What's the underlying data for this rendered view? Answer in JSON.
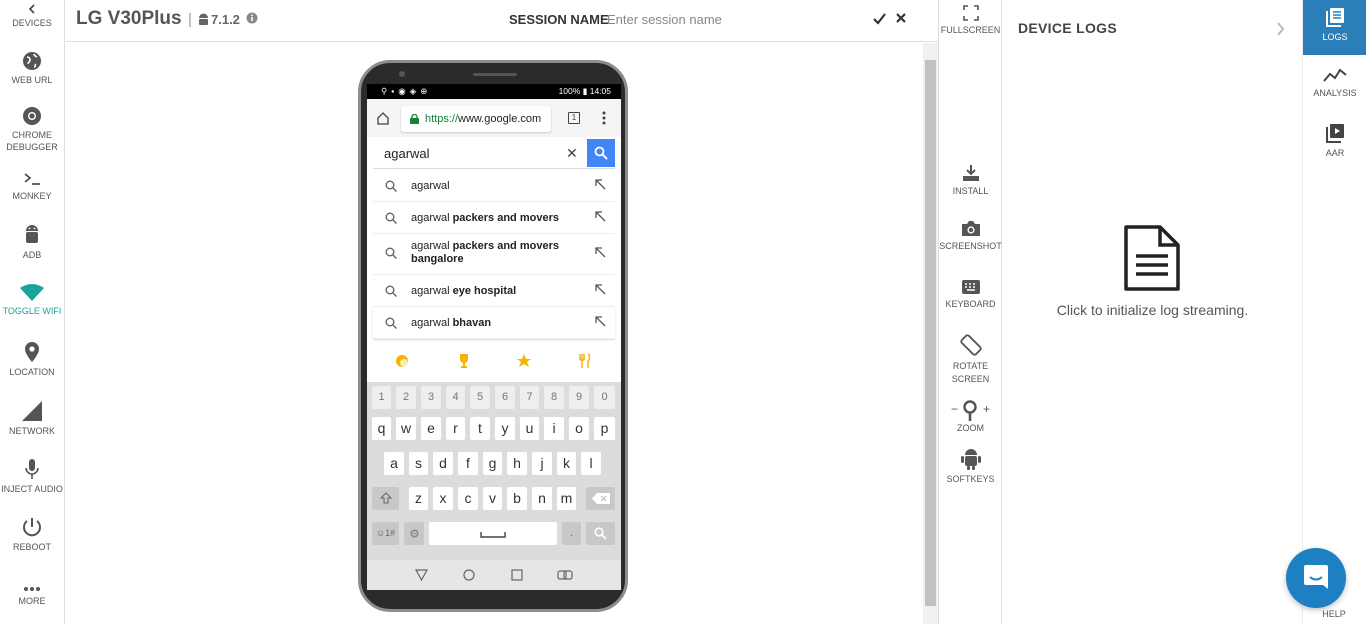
{
  "left_sidebar": {
    "devices": "DEVICES",
    "web_url": "WEB URL",
    "chrome_debugger": "CHROME DEBUGGER",
    "monkey": "MONKEY",
    "adb": "ADB",
    "toggle_wifi": "TOGGLE WIFI",
    "location": "LOCATION",
    "network": "NETWORK",
    "inject_audio": "INJECT AUDIO",
    "reboot": "REBOOT",
    "more": "MORE"
  },
  "header": {
    "device_name": "LG V30Plus",
    "separator": "|",
    "android_version": "7.1.2",
    "session_label": "SESSION NAME",
    "session_placeholder": "Enter session name"
  },
  "device_tools": {
    "fullscreen": "FULLSCREEN",
    "install": "INSTALL",
    "screenshot": "SCREENSHOT",
    "keyboard": "KEYBOARD",
    "rotate_screen": "ROTATE SCREEN",
    "zoom_minus": "−",
    "zoom_plus": "+",
    "zoom": "ZOOM",
    "softkeys": "SOFTKEYS"
  },
  "logs_panel": {
    "title": "DEVICE LOGS",
    "message": "Click to initialize log streaming."
  },
  "right_sidebar": {
    "logs": "LOGS",
    "analysis": "ANALYSIS",
    "aar": "AAR",
    "help": "HELP"
  },
  "phone": {
    "status": "100% ▮ 14:05",
    "url_scheme": "https://",
    "url_host": "www.google.com",
    "tabs_count": "1",
    "search_query": "agarwal",
    "suggestions": [
      {
        "base": "agarwal",
        "bold": ""
      },
      {
        "base": "agarwal ",
        "bold": "packers and movers"
      },
      {
        "base": "agarwal ",
        "bold": "packers and movers bangalore"
      },
      {
        "base": "agarwal ",
        "bold": "eye hospital"
      },
      {
        "base": "agarwal ",
        "bold": "bhavan"
      }
    ],
    "keyboard": {
      "numbers": [
        "1",
        "2",
        "3",
        "4",
        "5",
        "6",
        "7",
        "8",
        "9",
        "0"
      ],
      "row1": [
        "q",
        "w",
        "e",
        "r",
        "t",
        "y",
        "u",
        "i",
        "o",
        "p"
      ],
      "row2": [
        "a",
        "s",
        "d",
        "f",
        "g",
        "h",
        "j",
        "k",
        "l"
      ],
      "row3": [
        "z",
        "x",
        "c",
        "v",
        "b",
        "n",
        "m"
      ],
      "sym": "☺1#",
      "period": "."
    }
  },
  "colors": {
    "accent_teal": "#1aa39a",
    "active_blue": "#2b7fb8",
    "help_blue": "#1d80c3",
    "google_blue": "#4285f4",
    "secure_green": "#188038"
  }
}
